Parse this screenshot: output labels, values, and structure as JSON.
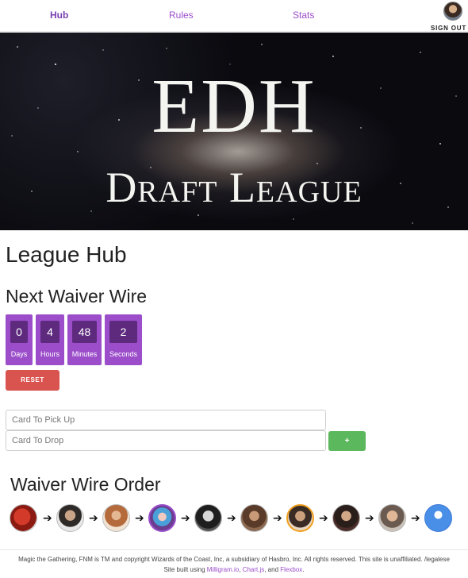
{
  "nav": {
    "hub": "Hub",
    "rules": "Rules",
    "stats": "Stats",
    "sign_out": "SIGN OUT"
  },
  "banner": {
    "line1": "EDH",
    "line2": "Draft League"
  },
  "page": {
    "title": "League Hub",
    "waiver_heading": "Next Waiver Wire",
    "order_heading": "Waiver Wire Order"
  },
  "countdown": {
    "days": {
      "value": "0",
      "label": "Days"
    },
    "hours": {
      "value": "4",
      "label": "Hours"
    },
    "minutes": {
      "value": "48",
      "label": "Minutes"
    },
    "seconds": {
      "value": "2",
      "label": "Seconds"
    }
  },
  "buttons": {
    "reset": "RESET",
    "add": "+"
  },
  "form": {
    "pick_placeholder": "Card To Pick Up",
    "drop_placeholder": "Card To Drop"
  },
  "order_arrow": "➔",
  "colors": {
    "accent": "#9b4dca",
    "countdown_inner": "#5e2a7e",
    "reset": "#d9534f",
    "add": "#5cb85c"
  },
  "footer": {
    "line1": "Magic the Gathering, FNM is TM and copyright Wizards of the Coast, Inc, a subsidiary of Hasbro, Inc. All rights reserved. This site is unaffiliated. /legalese",
    "built_prefix": "Site built using ",
    "milligram": "Milligram.io",
    "sep1": ", ",
    "chartjs": "Chart.js",
    "sep2": ", and ",
    "flexbox": "Flexbox",
    "end": "."
  }
}
